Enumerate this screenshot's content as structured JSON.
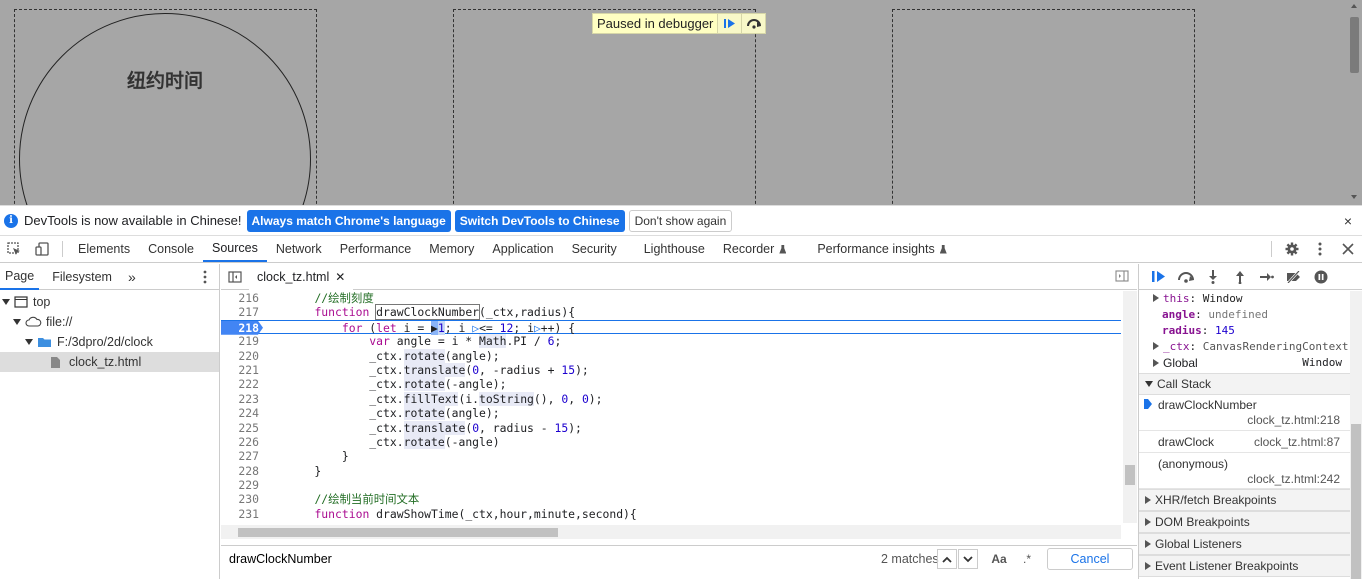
{
  "viewport": {
    "clock_title": "纽约时间",
    "paused_label": "Paused in debugger"
  },
  "infobar": {
    "message": "DevTools is now available in Chinese!",
    "btn_match": "Always match Chrome's language",
    "btn_switch": "Switch DevTools to Chinese",
    "btn_dismiss": "Don't show again",
    "close": "×"
  },
  "tabs": [
    "Elements",
    "Console",
    "Sources",
    "Network",
    "Performance",
    "Memory",
    "Application",
    "Security",
    "Lighthouse",
    "Recorder",
    "Performance insights"
  ],
  "active_tab": "Sources",
  "navigator": {
    "tab_page": "Page",
    "tab_filesystem": "Filesystem",
    "more": "»",
    "tree": {
      "top": "top",
      "origin": "file://",
      "folder": "F:/3dpro/2d/clock",
      "file": "clock_tz.html"
    }
  },
  "editor": {
    "file_tab": "clock_tz.html",
    "lines": [
      216,
      217,
      218,
      219,
      220,
      221,
      222,
      223,
      224,
      225,
      226,
      227,
      228,
      229,
      230,
      231
    ],
    "breakpoint_line": 218
  },
  "search": {
    "query": "drawClockNumber",
    "matches": "2 matches",
    "case_label": "Aa",
    "regex_label": ".*",
    "cancel": "Cancel"
  },
  "scope": {
    "this_key": "this",
    "this_val": "Window",
    "angle_key": "angle",
    "angle_val": "undefined",
    "radius_key": "radius",
    "radius_val": "145",
    "ctx_key": "_ctx",
    "ctx_val": "CanvasRenderingContext",
    "global_key": "Global",
    "global_val": "Window"
  },
  "call_stack": {
    "title": "Call Stack",
    "frames": [
      {
        "name": "drawClockNumber",
        "loc": "clock_tz.html:218"
      },
      {
        "name": "drawClock",
        "loc": "clock_tz.html:87"
      },
      {
        "name": "(anonymous)",
        "loc": "clock_tz.html:242"
      }
    ]
  },
  "panes": {
    "xhr": "XHR/fetch Breakpoints",
    "dom": "DOM Breakpoints",
    "global": "Global Listeners",
    "event": "Event Listener Breakpoints"
  },
  "colors": {
    "accent": "#1a73e8",
    "paused_bg": "#ffffc2",
    "viewport_bg": "#a6a6a6"
  }
}
